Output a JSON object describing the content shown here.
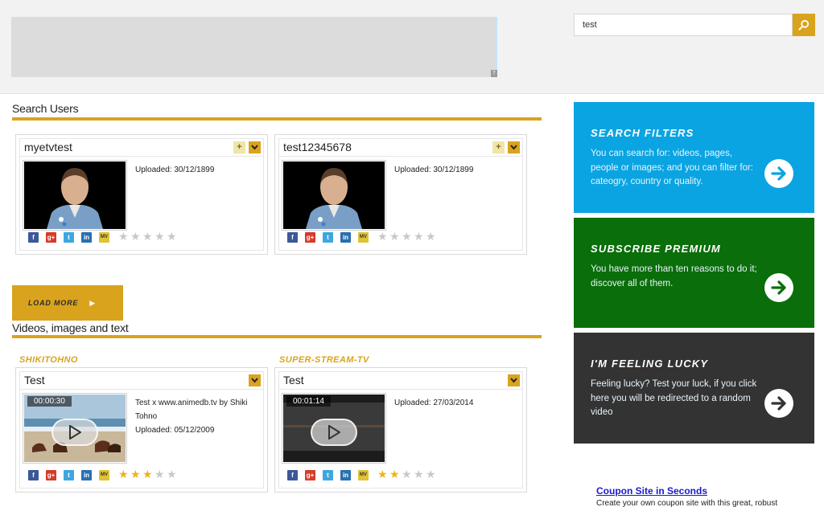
{
  "search": {
    "value": "test"
  },
  "sections": {
    "users_title": "Search Users",
    "media_title": "Videos, images and text",
    "load_more": "LOAD MORE"
  },
  "users": [
    {
      "name": "myetvtest",
      "uploaded": "Uploaded: 30/12/1899",
      "rating": 0
    },
    {
      "name": "test12345678",
      "uploaded": "Uploaded: 30/12/1899",
      "rating": 0
    }
  ],
  "media": [
    {
      "channel": "SHIKITOHNO",
      "title": "Test",
      "duration": "00:00:30",
      "desc": "Test x www.animedb.tv by Shiki Tohno",
      "uploaded": "Uploaded: 05/12/2009",
      "rating": 3
    },
    {
      "channel": "SUPER-STREAM-TV",
      "title": "Test",
      "duration": "00:01:14",
      "desc": "",
      "uploaded": "Uploaded: 27/03/2014",
      "rating": 2
    }
  ],
  "share_icons": [
    "facebook-icon",
    "google-plus-icon",
    "twitter-icon",
    "linkedin-icon",
    "myetv-icon"
  ],
  "promos": [
    {
      "title": "SEARCH FILTERS",
      "text": "You can search for: videos, pages, people or images; and you can filter for: cateogry, country or quality.",
      "color": "#0aa4e2"
    },
    {
      "title": "SUBSCRIBE PREMIUM",
      "text": "You have more than ten reasons to do it; discover all of them.",
      "color": "#0a6e0a"
    },
    {
      "title": "I'M FEELING LUCKY",
      "text": "Feeling lucky? Test your luck, if you click here you will be redirected to a random video",
      "color": "#333333"
    }
  ],
  "sponsor": {
    "link": "Coupon Site in Seconds",
    "text": "Create your own coupon site with this great, robust plugin!"
  },
  "colors": {
    "accent": "#d9a31d",
    "star_on": "#e8b61a",
    "star_off": "#c8c8c8"
  }
}
